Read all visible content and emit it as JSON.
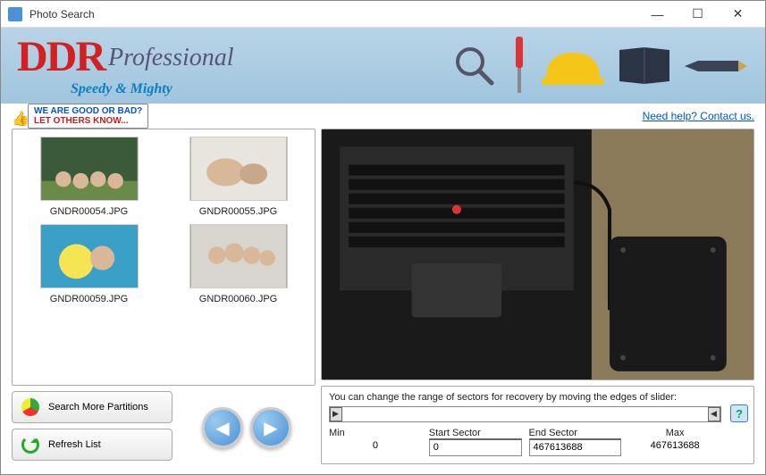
{
  "window": {
    "title": "Photo Search"
  },
  "banner": {
    "brand": "DDR",
    "product": "Professional",
    "tagline": "Speedy & Mighty"
  },
  "topbar": {
    "feedback_line1": "WE ARE GOOD OR BAD?",
    "feedback_line2": "LET OTHERS KNOW...",
    "help_link": "Need help? Contact us."
  },
  "thumbnails": [
    {
      "filename": "GNDR00054.JPG"
    },
    {
      "filename": "GNDR00055.JPG"
    },
    {
      "filename": "GNDR00059.JPG"
    },
    {
      "filename": "GNDR00060.JPG"
    }
  ],
  "buttons": {
    "search_partitions": "Search More Partitions",
    "refresh_list": "Refresh List"
  },
  "sector": {
    "instruction": "You can change the range of sectors for recovery by moving the edges of slider:",
    "min_label": "Min",
    "min_value": "0",
    "start_label": "Start Sector",
    "start_value": "0",
    "end_label": "End Sector",
    "end_value": "467613688",
    "max_label": "Max",
    "max_value": "467613688",
    "help": "?"
  }
}
